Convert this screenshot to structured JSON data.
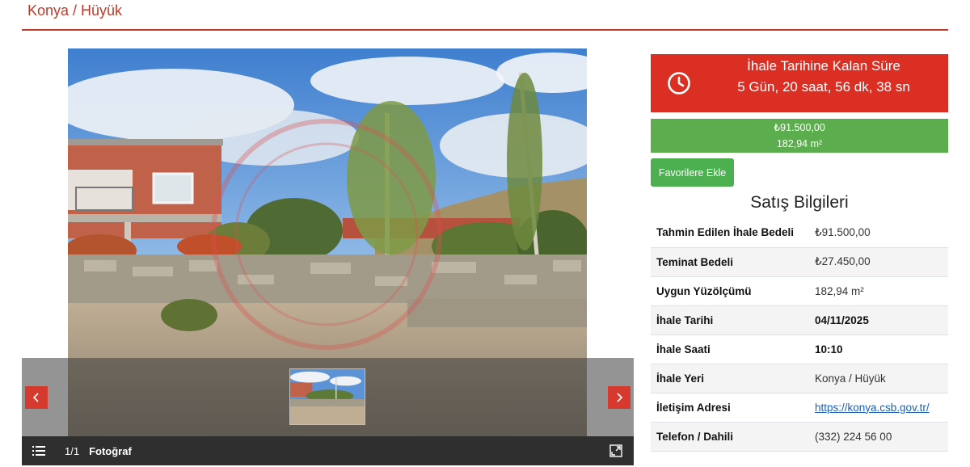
{
  "header": {
    "title": "Konya / Hüyük"
  },
  "gallery": {
    "counter": "1/1",
    "caption": "Fotoğraf",
    "icons": {
      "prev": "chevron-left-icon",
      "next": "chevron-right-icon",
      "list": "list-icon",
      "expand": "expand-icon"
    }
  },
  "countdown": {
    "title": "İhale Tarihine Kalan Süre",
    "value": "5 Gün, 20 saat, 56 dk, 38 sn",
    "icon": "clock-icon"
  },
  "price": {
    "amount": "₺91.500,00",
    "area": "182,94 m²"
  },
  "favorite_button": {
    "label": "Favorilere Ekle"
  },
  "sale_info": {
    "title": "Satış Bilgileri",
    "rows": [
      {
        "key": "Tahmin Edilen İhale Bedeli",
        "value": "₺91.500,00"
      },
      {
        "key": "Teminat Bedeli",
        "value": "₺27.450,00"
      },
      {
        "key": "Uygun Yüzölçümü",
        "value": "182,94 m²"
      },
      {
        "key": "İhale Tarihi",
        "value": "04/11/2025"
      },
      {
        "key": "İhale Saati",
        "value": "10:10"
      },
      {
        "key": "İhale Yeri",
        "value": "Konya / Hüyük"
      },
      {
        "key": "İletişim Adresi",
        "value": "https://konya.csb.gov.tr/"
      },
      {
        "key": "Telefon / Dahili",
        "value": "(332) 224 56 00"
      }
    ]
  },
  "colors": {
    "accent": "#c0392b",
    "countdown": "#dc2f24",
    "price": "#5cad4d",
    "favorite": "#4caf50",
    "link": "#1a5fb4"
  }
}
